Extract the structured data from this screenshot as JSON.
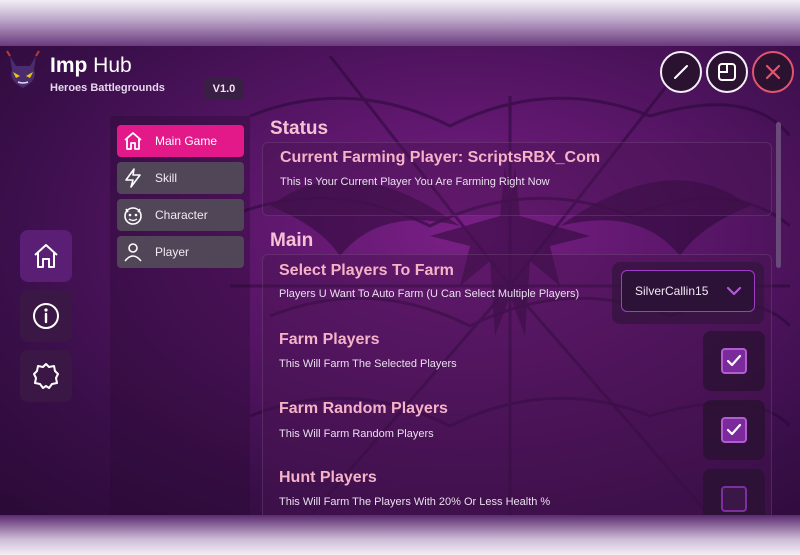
{
  "header": {
    "app_name_bold": "Imp",
    "app_name_rest": " Hub",
    "game_name": "Heroes Battlegrounds",
    "version": "V1.0",
    "buttons": [
      "edit-icon",
      "minimize-window-icon",
      "close-icon"
    ]
  },
  "sidebar": {
    "items": [
      {
        "icon": "home-icon",
        "active": true
      },
      {
        "icon": "info-icon",
        "active": false
      },
      {
        "icon": "settings-icon",
        "active": false
      }
    ]
  },
  "menu": {
    "items": [
      {
        "label": "Main Game",
        "icon": "home-icon",
        "active": true
      },
      {
        "label": "Skill",
        "icon": "lightning-icon",
        "active": false
      },
      {
        "label": "Character",
        "icon": "demon-face-icon",
        "active": false
      },
      {
        "label": "Player",
        "icon": "user-icon",
        "active": false
      }
    ]
  },
  "status": {
    "section_title": "Status",
    "current_player_title": "Current Farming Player: ScriptsRBX_Com",
    "current_player_desc": "This Is Your Current Player You Are Farming Right Now"
  },
  "main": {
    "section_title": "Main",
    "select_players": {
      "title": "Select Players To Farm",
      "desc": "Players U Want To Auto Farm (U Can Select Multiple Players)",
      "selected_value": "SilverCallin15"
    },
    "options": [
      {
        "title": "Farm Players",
        "desc": "This Will Farm The Selected Players",
        "checked": true
      },
      {
        "title": "Farm Random Players",
        "desc": "This Will Farm Random Players",
        "checked": true
      },
      {
        "title": "Hunt Players",
        "desc": "This Will Farm The Players With 20% Or Less Health %",
        "checked": false
      }
    ]
  },
  "colors": {
    "accent": "#e3198a",
    "title_pink": "#f6b3c8",
    "checkbox_checked": "#7b2a9b"
  }
}
